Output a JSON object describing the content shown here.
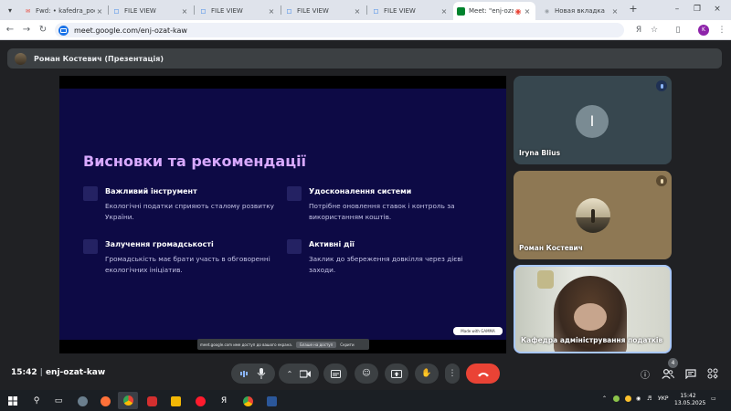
{
  "browser": {
    "tabs": [
      {
        "title": "Fwd: • kafedra_podat",
        "favicon": "gmail-icon",
        "active": false
      },
      {
        "title": "FILE VIEW",
        "favicon": "file-icon",
        "active": false
      },
      {
        "title": "FILE VIEW",
        "favicon": "file-icon",
        "active": false
      },
      {
        "title": "FILE VIEW",
        "favicon": "file-icon",
        "active": false
      },
      {
        "title": "FILE VIEW",
        "favicon": "file-icon",
        "active": false
      },
      {
        "title": "Meet: \"enj-ozat",
        "favicon": "meet-icon",
        "active": true
      },
      {
        "title": "Новая вкладка",
        "favicon": "chrome-icon",
        "active": false
      }
    ],
    "url": "meet.google.com/enj-ozat-kaw",
    "profile_initial": "K"
  },
  "meet": {
    "presenter_label": "Роман Костевич (Презентація)",
    "slide": {
      "title": "Висновки та рекомендації",
      "cards": [
        {
          "heading": "Важливий інструмент",
          "text": "Екологічні податки сприяють сталому розвитку України."
        },
        {
          "heading": "Удосконалення системи",
          "text": "Потрібне оновлення ставок і контроль за використанням коштів."
        },
        {
          "heading": "Залучення громадськості",
          "text": "Громадськість має брати участь в обговоренні екологічних ініціатив."
        },
        {
          "heading": "Активні дії",
          "text": "Заклик до збереження довкілля через дієві заходи."
        }
      ],
      "made_with": "Made with GAMMA"
    },
    "share_notice": {
      "text": "meet.google.com име доступ до вашого екрана.",
      "stop_label": "Блаше на доступ",
      "hide_label": "Скрити"
    },
    "participants": [
      {
        "name": "Iryna Blius",
        "initial": "I",
        "muted": true
      },
      {
        "name": "Роман Костевич",
        "muted": true
      },
      {
        "name": "Кафедра адміністрування податків",
        "speaking": true
      }
    ],
    "time": "15:42",
    "meeting_code": "enj-ozat-kaw",
    "participant_count": "4"
  },
  "taskbar": {
    "language": "УКР",
    "time": "15:42",
    "date": "13.05.2025"
  },
  "colors": {
    "slide_bg": "#0d0a45",
    "slide_title": "#d8a9ff",
    "end_call": "#ea4335",
    "meet_bg": "#202124"
  }
}
